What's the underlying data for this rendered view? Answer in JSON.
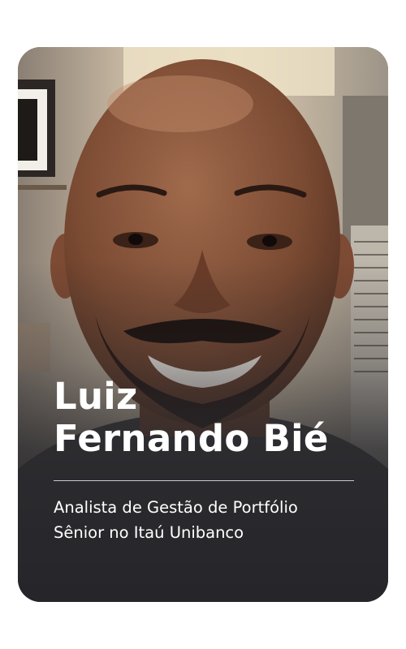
{
  "card": {
    "name_line1": "Luiz",
    "name_line2": "Fernando Bié",
    "role_line1": "Analista de Gestão de Portfólio",
    "role_line2": "Sênior no Itaú Unibanco"
  },
  "colors": {
    "text": "#ffffff",
    "card_bottom": "#26262a",
    "page_background": "#ffffff"
  }
}
